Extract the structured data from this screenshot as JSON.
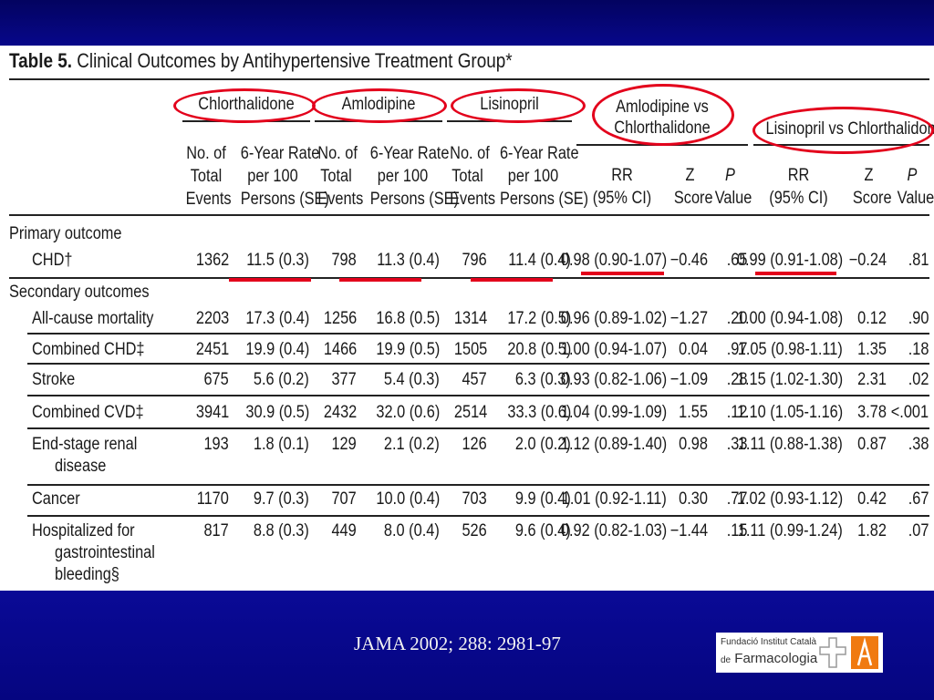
{
  "slide": {
    "table_number": "Table 5.",
    "table_title": "Clinical Outcomes by Antihypertensive Treatment Group*",
    "citation": "JAMA 2002; 288: 2981-97",
    "logo": {
      "line1": "Fundació Institut Català",
      "prefix": "de",
      "line2": "Farmacologia"
    }
  },
  "groups": {
    "g1": "Chlorthalidone",
    "g2": "Amlodipine",
    "g3": "Lisinopril",
    "g4_line1": "Amlodipine vs",
    "g4_line2": "Chlorthalidone",
    "g5": "Lisinopril vs Chlorthalidone"
  },
  "col_headers": {
    "events": [
      "No. of",
      "Total",
      "Events"
    ],
    "rate": [
      "6-Year Rate",
      "per 100",
      "Persons (SE)"
    ],
    "rr": [
      "RR",
      "(95% CI)"
    ],
    "z": [
      "Z",
      "Score"
    ],
    "p": [
      "P",
      "Value"
    ]
  },
  "sections": {
    "primary": "Primary outcome",
    "secondary": "Secondary outcomes"
  },
  "rows": [
    {
      "label": [
        "CHD†"
      ],
      "v": [
        "1362",
        "11.5 (0.3)",
        "798",
        "11.3 (0.4)",
        "796",
        "11.4 (0.4)",
        "0.98 (0.90-1.07)",
        "−0.46",
        ".65",
        "0.99 (0.91-1.08)",
        "−0.24",
        ".81"
      ]
    },
    {
      "label": [
        "All-cause mortality"
      ],
      "v": [
        "2203",
        "17.3 (0.4)",
        "1256",
        "16.8 (0.5)",
        "1314",
        "17.2 (0.5)",
        "0.96 (0.89-1.02)",
        "−1.27",
        ".20",
        "1.00 (0.94-1.08)",
        "0.12",
        ".90"
      ]
    },
    {
      "label": [
        "Combined CHD‡"
      ],
      "v": [
        "2451",
        "19.9 (0.4)",
        "1466",
        "19.9 (0.5)",
        "1505",
        "20.8 (0.5)",
        "1.00 (0.94-1.07)",
        "0.04",
        ".97",
        "1.05 (0.98-1.11)",
        "1.35",
        ".18"
      ]
    },
    {
      "label": [
        "Stroke"
      ],
      "v": [
        "675",
        "5.6 (0.2)",
        "377",
        "5.4 (0.3)",
        "457",
        "6.3 (0.3)",
        "0.93 (0.82-1.06)",
        "−1.09",
        ".28",
        "1.15 (1.02-1.30)",
        "2.31",
        ".02"
      ]
    },
    {
      "label": [
        "Combined CVD‡"
      ],
      "v": [
        "3941",
        "30.9 (0.5)",
        "2432",
        "32.0 (0.6)",
        "2514",
        "33.3 (0.6)",
        "1.04 (0.99-1.09)",
        "1.55",
        ".12",
        "1.10 (1.05-1.16)",
        "3.78",
        "<.001"
      ]
    },
    {
      "label": [
        "End-stage renal",
        "disease"
      ],
      "v": [
        "193",
        "1.8 (0.1)",
        "129",
        "2.1 (0.2)",
        "126",
        "2.0 (0.2)",
        "1.12 (0.89-1.40)",
        "0.98",
        ".33",
        "1.11 (0.88-1.38)",
        "0.87",
        ".38"
      ]
    },
    {
      "label": [
        "Cancer"
      ],
      "v": [
        "1170",
        "9.7 (0.3)",
        "707",
        "10.0 (0.4)",
        "703",
        "9.9 (0.4)",
        "1.01 (0.92-1.11)",
        "0.30",
        ".77",
        "1.02 (0.93-1.12)",
        "0.42",
        ".67"
      ]
    },
    {
      "label": [
        "Hospitalized for",
        "gastrointestinal",
        "bleeding§"
      ],
      "v": [
        "817",
        "8.8 (0.3)",
        "449",
        "8.0 (0.4)",
        "526",
        "9.6 (0.4)",
        "0.92 (0.82-1.03)",
        "−1.44",
        ".15",
        "1.11 (0.99-1.24)",
        "1.82",
        ".07"
      ]
    }
  ],
  "colors": {
    "band": "#050573",
    "highlight": "#e3001b",
    "text": "#1a1a1a"
  }
}
